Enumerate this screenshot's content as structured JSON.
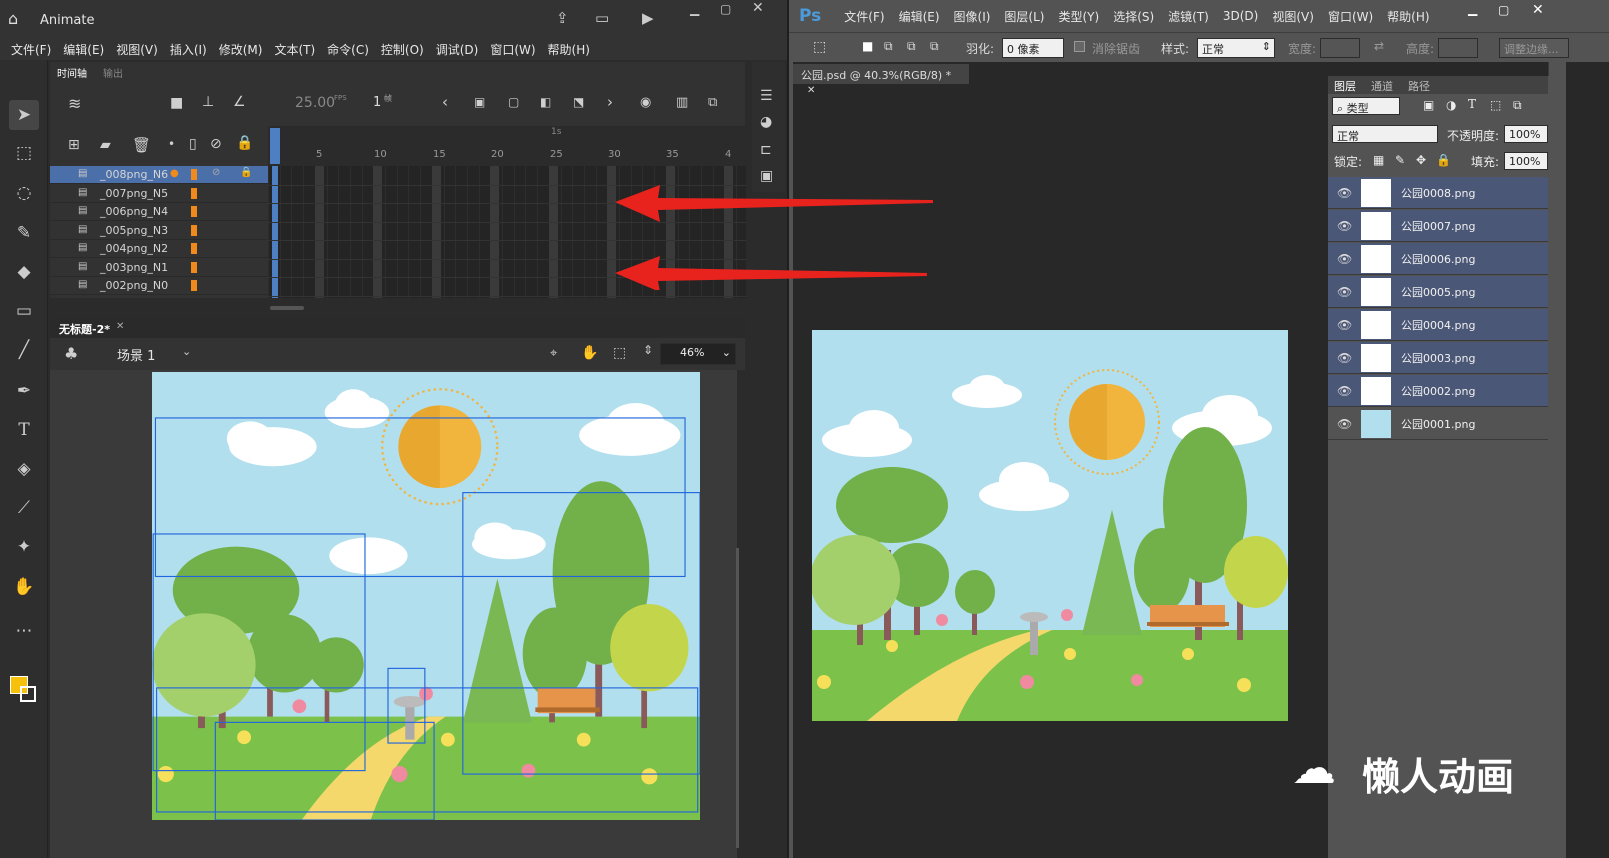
{
  "animate": {
    "app_title": "Animate",
    "menu": [
      "文件(F)",
      "编辑(E)",
      "视图(V)",
      "插入(I)",
      "修改(M)",
      "文本(T)",
      "命令(C)",
      "控制(O)",
      "调试(D)",
      "窗口(W)",
      "帮助(H)"
    ],
    "timeline_tab": "时间轴",
    "output_tab": "输出",
    "fps": "25.00",
    "fps_unit": "FPS",
    "current_frame": "1",
    "frame_unit": "帧",
    "ruler_second": "1s",
    "ruler_numbers": [
      "5",
      "10",
      "15",
      "20",
      "25",
      "30",
      "35",
      "4"
    ],
    "layers": [
      "_008png_N6",
      "_007png_N5",
      "_006png_N4",
      "_005png_N3",
      "_004png_N2",
      "_003png_N1",
      "_002png_N0"
    ],
    "document_tab": "无标题-2*",
    "scene": "场景 1",
    "zoom": "46%"
  },
  "photoshop": {
    "logo": "Ps",
    "menu": [
      "文件(F)",
      "编辑(E)",
      "图像(I)",
      "图层(L)",
      "类型(Y)",
      "选择(S)",
      "滤镜(T)",
      "3D(D)",
      "视图(V)",
      "窗口(W)",
      "帮助(H)"
    ],
    "feather_label": "羽化:",
    "feather_value": "0 像素",
    "antialias_label": "消除锯齿",
    "style_label": "样式:",
    "style_value": "正常",
    "width_label": "宽度:",
    "height_label": "高度:",
    "refine_edge_label": "调整边缘...",
    "doc_tab": "公园.psd @ 40.3%(RGB/8) *",
    "panel_tabs": [
      "图层",
      "通道",
      "路径"
    ],
    "filter_kind": "类型",
    "blend_mode": "正常",
    "opacity_label": "不透明度:",
    "opacity_value": "100%",
    "lock_label": "锁定:",
    "fill_label": "填充:",
    "fill_value": "100%",
    "layers": [
      "公园0008.png",
      "公园0007.png",
      "公园0006.png",
      "公园0005.png",
      "公园0004.png",
      "公园0003.png",
      "公园0002.png",
      "公园0001.png"
    ]
  },
  "watermark": "懒人动画",
  "colors": {
    "arrow": "#e8231e",
    "sky": "#b2dfee",
    "grass": "#7cc24a",
    "sun": "#f1b53d",
    "layer_selected": "#4b5776"
  }
}
